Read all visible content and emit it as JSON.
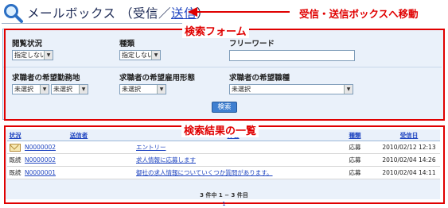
{
  "header": {
    "title_prefix": "メールボックス （受信／",
    "title_link": "送信",
    "title_suffix": "）"
  },
  "annotations": {
    "move": "受信・送信ボックスへ移動",
    "search_form": "検索フォーム",
    "results_list": "検索結果の一覧"
  },
  "form": {
    "read_status": {
      "label": "閲覧状況",
      "value": "指定しない"
    },
    "type": {
      "label": "種類",
      "value": "指定しない"
    },
    "freeword": {
      "label": "フリーワード",
      "value": ""
    },
    "location": {
      "label": "求職者の希望勤務地",
      "value1": "未選択",
      "value2": "未選択"
    },
    "employment": {
      "label": "求職者の希望雇用形態",
      "value": "未選択"
    },
    "occupation": {
      "label": "求職者の希望職種",
      "value": "未選択"
    },
    "search_button": "検索"
  },
  "results": {
    "headers": {
      "status": "状況",
      "sender": "送信者",
      "subject": "件名",
      "type": "種類",
      "date": "受信日"
    },
    "rows": [
      {
        "status": "",
        "status_icon": "envelope-icon",
        "sender": "N0000002",
        "subject": "エントリー",
        "type": "応募",
        "date": "2010/02/12 12:13"
      },
      {
        "status": "既読",
        "status_icon": "",
        "sender": "N0000002",
        "subject": "求人情報に応募します",
        "type": "応募",
        "date": "2010/02/04 14:26"
      },
      {
        "status": "既読",
        "status_icon": "",
        "sender": "N0000001",
        "subject": "御社の求人情報についていくつか質問があります。",
        "type": "応募",
        "date": "2010/02/04 14:11"
      }
    ],
    "pager_summary": "3 件中 1 − 3 件目",
    "page_number": "1"
  },
  "colors": {
    "annotation_red": "#e00000",
    "link_blue": "#1f45c0",
    "panel_bg": "#eaf1fa"
  }
}
